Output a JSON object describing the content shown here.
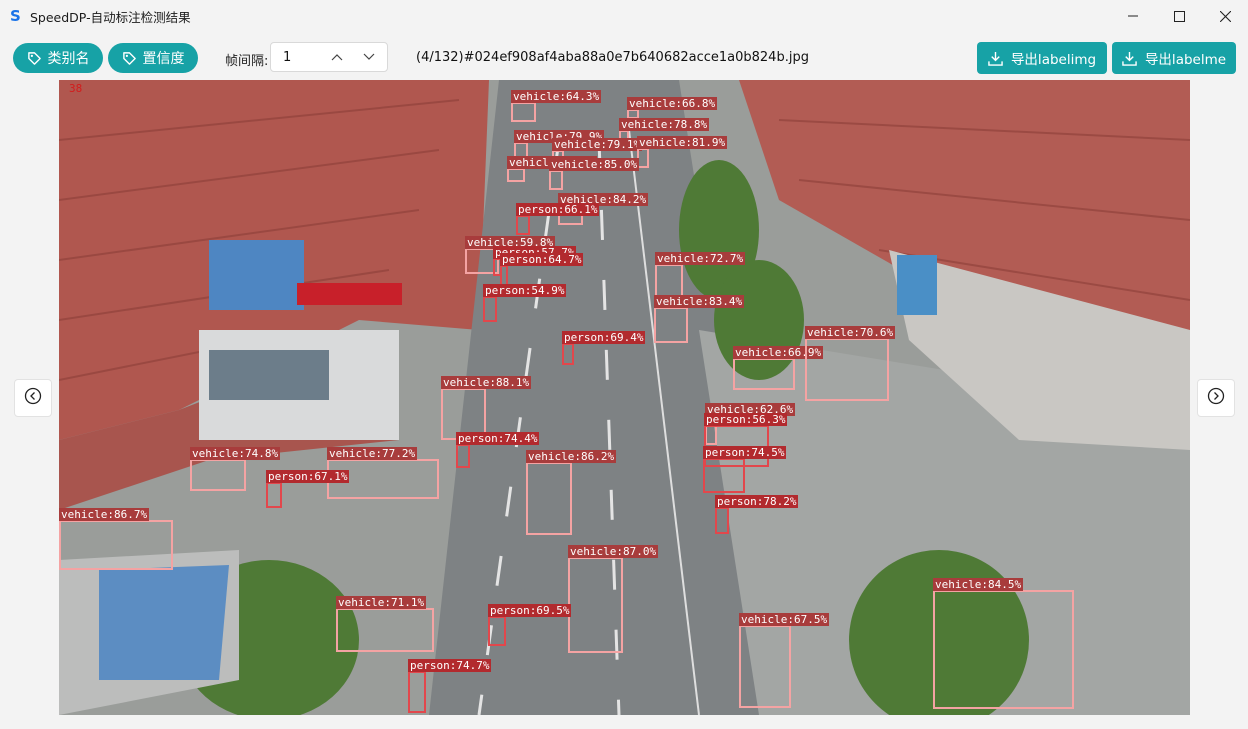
{
  "window": {
    "title": "SpeedDP-自动标注检测结果",
    "app_icon": "s-logo-icon"
  },
  "toolbar": {
    "class_name_btn": "类别名",
    "confidence_btn": "置信度",
    "interval_label": "帧间隔:",
    "interval_value": "1",
    "file_info": "(4/132)#024ef908af4aba88a0e7b640682acce1a0b824b.jpg",
    "export_labelimg": "导出labelimg",
    "export_labelme": "导出labelme"
  },
  "viewer": {
    "frame_number": "38",
    "colors": {
      "vehicle": "#f4a3a3",
      "person": "#e2474c"
    }
  },
  "detections": [
    {
      "cls": "vehicle",
      "conf": "vehicle:64.3%",
      "label": "vehicle:64.3%"
    },
    {
      "cls": "vehicle",
      "label": "vehicle:66.8%"
    },
    {
      "cls": "vehicle",
      "label": "vehicle:78.8%"
    },
    {
      "cls": "vehicle",
      "label": "vehicle:79.9%"
    },
    {
      "cls": "vehicle",
      "label": "vehicle:79.1%"
    },
    {
      "cls": "vehicle",
      "label": "vehicle:81.9%"
    },
    {
      "cls": "vehicle",
      "label": "vehicle:65.3%"
    },
    {
      "cls": "vehicle",
      "label": "vehicle:85.0%"
    },
    {
      "cls": "vehicle",
      "label": "vehicle:84.2%"
    },
    {
      "cls": "person",
      "label": "person:66.1%"
    },
    {
      "cls": "vehicle",
      "label": "vehicle:59.8%"
    },
    {
      "cls": "person",
      "label": "person:57.7%"
    },
    {
      "cls": "person",
      "label": "person:64.7%"
    },
    {
      "cls": "person",
      "label": "person:54.9%"
    },
    {
      "cls": "vehicle",
      "label": "vehicle:72.7%"
    },
    {
      "cls": "vehicle",
      "label": "vehicle:83.4%"
    },
    {
      "cls": "person",
      "label": "person:69.4%"
    },
    {
      "cls": "vehicle",
      "label": "vehicle:66.9%"
    },
    {
      "cls": "vehicle",
      "label": "vehicle:70.6%"
    },
    {
      "cls": "vehicle",
      "label": "vehicle:88.1%"
    },
    {
      "cls": "vehicle",
      "label": "vehicle:62.6%"
    },
    {
      "cls": "person",
      "label": "person:56.3%"
    },
    {
      "cls": "person",
      "label": "person:74.4%"
    },
    {
      "cls": "vehicle",
      "label": "vehicle:77.2%"
    },
    {
      "cls": "vehicle",
      "label": "vehicle:74.8%"
    },
    {
      "cls": "person",
      "label": "person:67.1%"
    },
    {
      "cls": "vehicle",
      "label": "vehicle:86.2%"
    },
    {
      "cls": "person",
      "label": "person:74.5%"
    },
    {
      "cls": "person",
      "label": "person:78.2%"
    },
    {
      "cls": "vehicle",
      "label": "vehicle:86.7%"
    },
    {
      "cls": "vehicle",
      "label": "vehicle:87.0%"
    },
    {
      "cls": "vehicle",
      "label": "vehicle:84.5%"
    },
    {
      "cls": "vehicle",
      "label": "vehicle:71.1%"
    },
    {
      "cls": "person",
      "label": "person:69.5%"
    },
    {
      "cls": "vehicle",
      "label": "vehicle:67.5%"
    },
    {
      "cls": "person",
      "label": "person:74.7%"
    }
  ],
  "icons": {
    "minimize": "minimize-icon",
    "maximize": "maximize-icon",
    "close": "close-icon",
    "tag": "tag-icon",
    "download": "download-icon",
    "prev": "arrow-left-circle-icon",
    "next": "arrow-right-circle-icon",
    "up": "chevron-up-icon",
    "down": "chevron-down-icon"
  }
}
